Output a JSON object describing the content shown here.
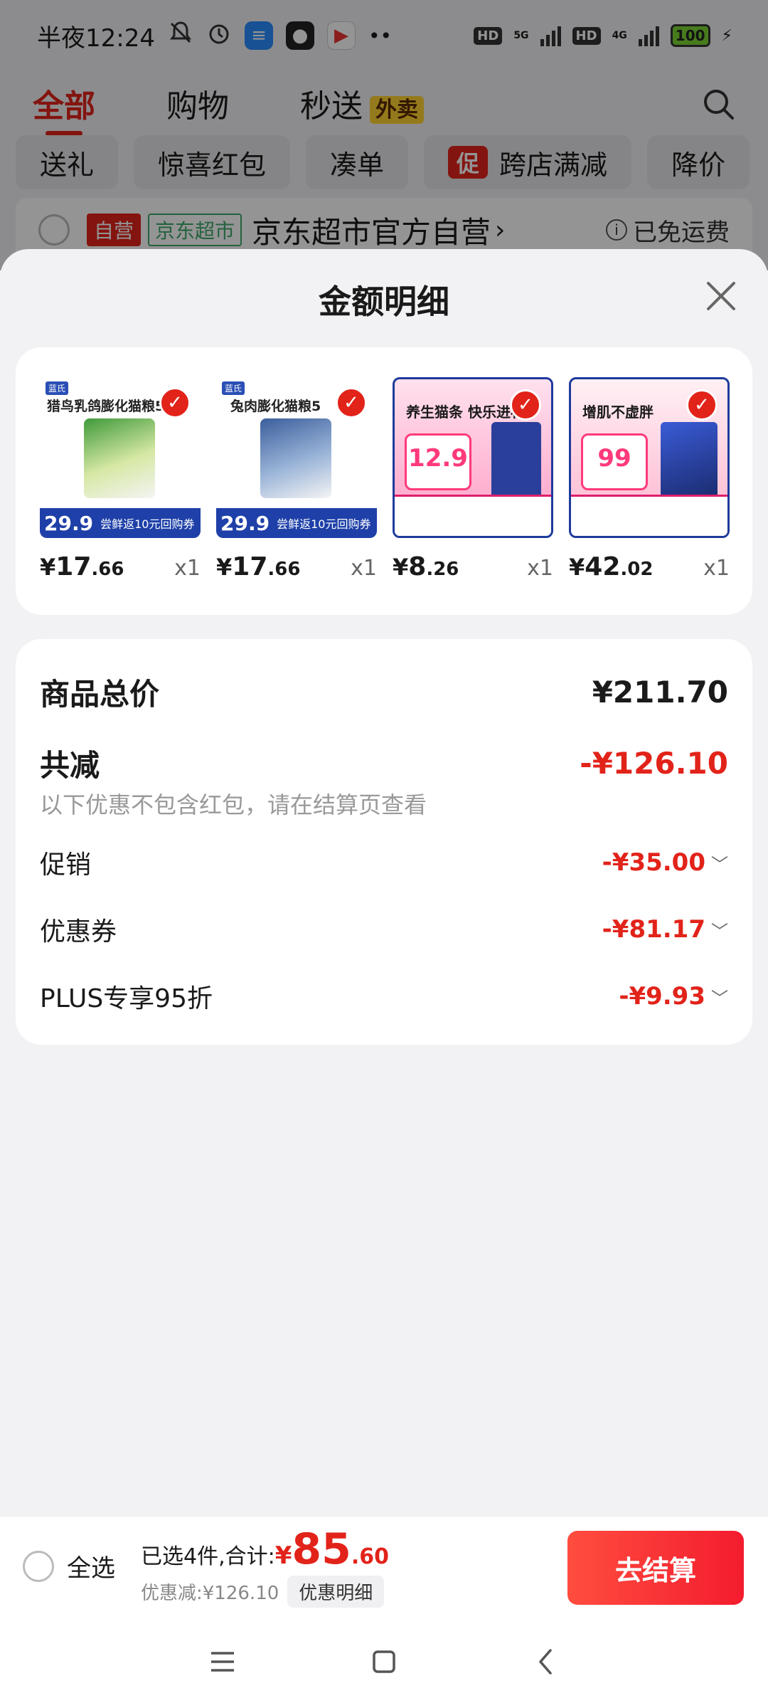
{
  "status_bar": {
    "time": "半夜12:24",
    "battery": "100",
    "net1": "5G",
    "net2": "4G",
    "hd1": "HD",
    "hd2": "HD"
  },
  "top_tabs": [
    {
      "label": "全部",
      "active": true
    },
    {
      "label": "购物",
      "active": false
    },
    {
      "label": "秒送",
      "active": false,
      "badge": "外卖"
    }
  ],
  "filter_chips": [
    "送礼",
    "惊喜红包",
    "凑单",
    "跨店满减",
    "降价"
  ],
  "promo_chip_badge": "促",
  "store": {
    "tag_self": "自营",
    "tag_market": "京东超市",
    "name": "京东超市官方自营",
    "arrow": "›",
    "shipping": "已免运费",
    "info": "i"
  },
  "sheet": {
    "title": "金额明细",
    "products": [
      {
        "title": "猎鸟乳鸽膨化猫粮5g",
        "price_symbol": "¥",
        "price_int": "17",
        "price_dec": ".66",
        "qty": "x1",
        "bottom_price": "29.9",
        "bottom_text": "尝鲜返10元回购券"
      },
      {
        "title": "兔肉膨化猫粮5",
        "price_symbol": "¥",
        "price_int": "17",
        "price_dec": ".66",
        "qty": "x1",
        "bottom_price": "29.9",
        "bottom_text": "尝鲜返10元回购券"
      },
      {
        "title": "养生猫条 快乐进补",
        "price_symbol": "¥",
        "price_int": "8",
        "price_dec": ".26",
        "qty": "x1",
        "promo_price": "12.9"
      },
      {
        "title": "增肌不虚胖",
        "price_symbol": "¥",
        "price_int": "42",
        "price_dec": ".02",
        "qty": "x1",
        "promo_price": "99"
      }
    ],
    "summary": {
      "total_label": "商品总价",
      "total_value": "¥211.70",
      "reduce_label": "共减",
      "reduce_value": "-¥126.10",
      "note": "以下优惠不包含红包，请在结算页查看",
      "lines": [
        {
          "label": "促销",
          "value": "-¥35.00"
        },
        {
          "label": "优惠券",
          "value": "-¥81.17"
        },
        {
          "label": "PLUS专享95折",
          "value": "-¥9.93"
        }
      ]
    }
  },
  "bottom_bar": {
    "select_all": "全选",
    "selected_text": "已选4件,合计:",
    "total_symbol": "¥",
    "total_int": "85",
    "total_dec": ".60",
    "discount_text": "优惠减:¥126.10",
    "detail_button": "优惠明细",
    "checkout_button": "去结算"
  },
  "colors": {
    "accent": "#e2231a",
    "checkout": "#f31c2e"
  }
}
